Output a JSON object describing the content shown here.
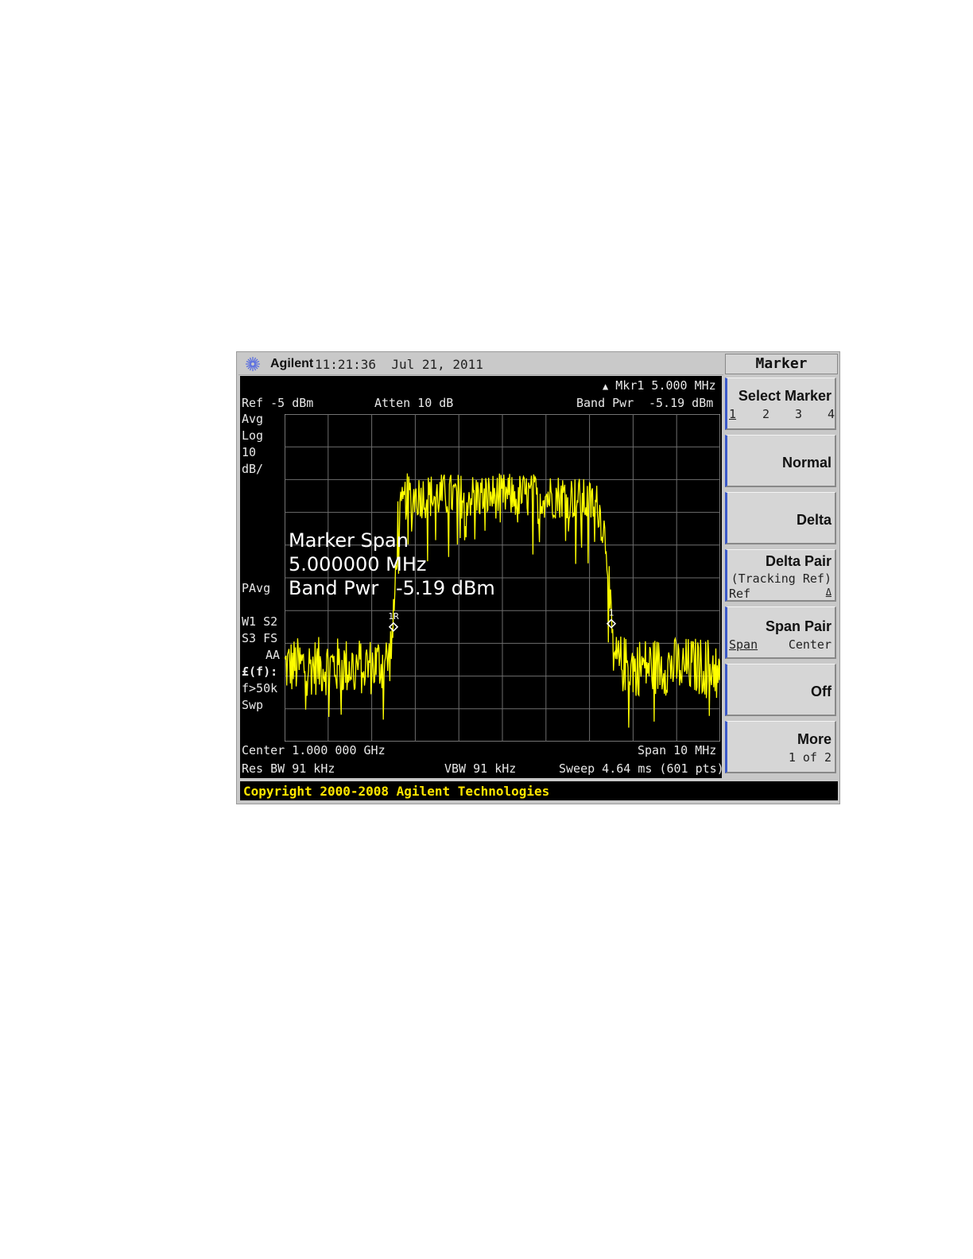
{
  "header": {
    "brand": "Agilent",
    "time": "11:21:36",
    "date": "Jul 21, 2011"
  },
  "status": {
    "marker_line": "Mkr1  5.000 MHz",
    "ref": "Ref -5 dBm",
    "atten": "Atten 10 dB",
    "band_pwr_label": "Band Pwr",
    "band_pwr_value": "-5.19 dBm"
  },
  "left_annotations": {
    "avg": "Avg",
    "log": "Log",
    "scale": "10",
    "unit": "dB/",
    "pavg": "PAvg",
    "w1s2": "W1  S2",
    "s3fs": "S3  FS",
    "aa": "AA",
    "ef": "£(f):",
    "f50k": "f>50k",
    "swp": "Swp"
  },
  "overlay": {
    "line1": "Marker Span",
    "line2": "5.000000 MHz",
    "line3_label": "Band Pwr",
    "line3_value": "-5.19 dBm"
  },
  "markers": {
    "ref_label": "1R",
    "delta_label": "1"
  },
  "footer": {
    "center": "Center 1.000 000 GHz",
    "span": "Span 10 MHz",
    "res_bw": "Res BW 91 kHz",
    "vbw": "VBW 91 kHz",
    "sweep": "Sweep 4.64 ms (601 pts)"
  },
  "softkeys": {
    "title": "Marker",
    "select_marker": {
      "label": "Select Marker",
      "options": [
        "1",
        "2",
        "3",
        "4"
      ]
    },
    "normal": "Normal",
    "delta": "Delta",
    "delta_pair": {
      "label": "Delta Pair",
      "sub": "(Tracking Ref)",
      "left": "Ref",
      "right": "Δ"
    },
    "span_pair": {
      "label": "Span Pair",
      "left": "Span",
      "right": "Center"
    },
    "off": "Off",
    "more": {
      "label": "More",
      "sub": "1 of 2"
    }
  },
  "copyright": "Copyright 2000-2008 Agilent Technologies",
  "colors": {
    "trace": "#ffff00",
    "screen": "#000000",
    "grid": "#6e6e6e",
    "softkey_accent": "#3a58c8"
  },
  "chart_data": {
    "type": "line",
    "title": "",
    "xlabel": "",
    "ylabel": "",
    "x_center_ghz": 1.0,
    "x_span_mhz": 10,
    "ylim": [
      -105,
      -5
    ],
    "y_scale_db_per_div": 10,
    "grid": true,
    "points": 601,
    "series": [
      {
        "x_mhz": [
          -5.0,
          -4.0,
          -3.0,
          -2.6,
          -2.5,
          -2.4,
          -2.2,
          -1.5,
          0.0,
          1.5,
          2.2,
          2.4,
          2.5,
          2.6,
          3.0,
          4.0,
          5.0
        ],
        "y_dbm": [
          -82,
          -82,
          -82,
          -80,
          -70,
          -38,
          -30,
          -30,
          -30,
          -30,
          -33,
          -45,
          -72,
          -81,
          -82,
          -82,
          -82
        ]
      }
    ],
    "markers": [
      {
        "name": "1R",
        "x_mhz": -2.5,
        "y_dbm": -70
      },
      {
        "name": "1",
        "x_mhz": 2.5,
        "y_dbm": -69
      }
    ]
  }
}
